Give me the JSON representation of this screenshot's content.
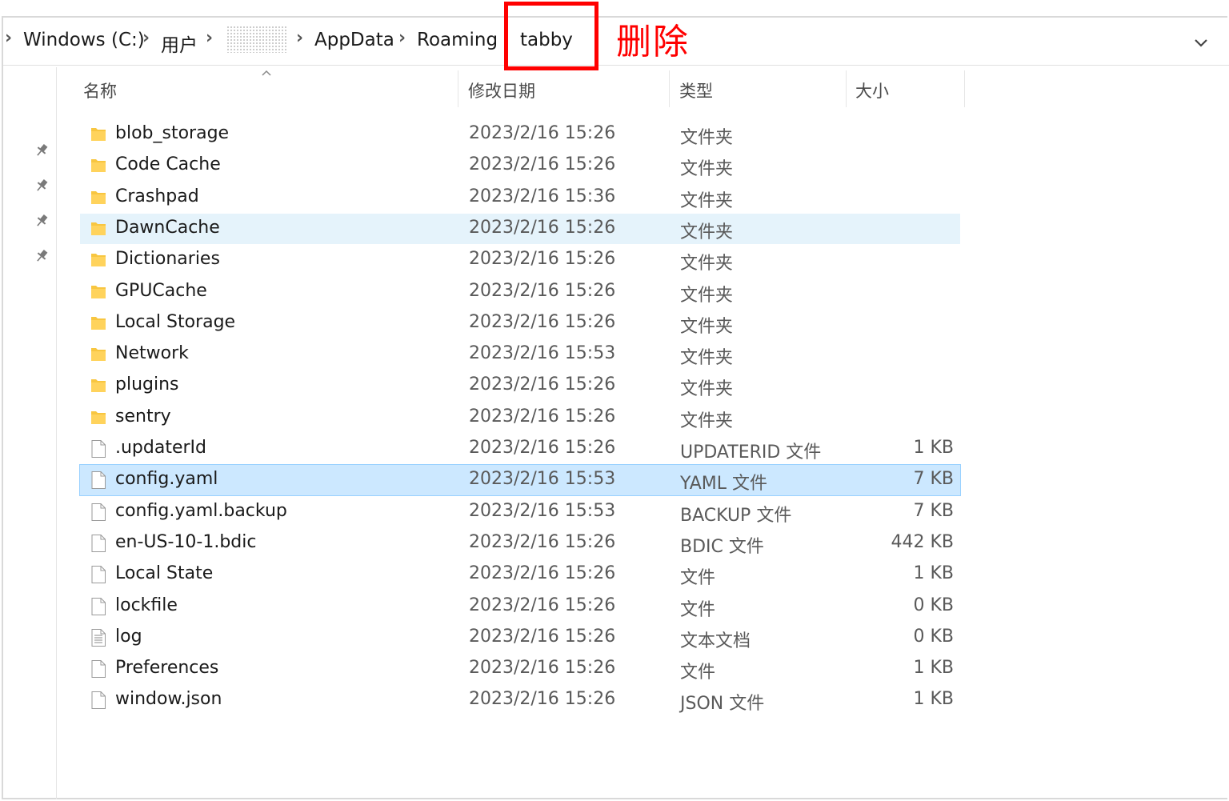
{
  "breadcrumb": {
    "items": [
      "Windows (C:)",
      "用户",
      "",
      "AppData",
      "Roaming",
      "tabby"
    ]
  },
  "annotation": {
    "text": "删除",
    "color": "#ff0000"
  },
  "columns": {
    "name": "名称",
    "date": "修改日期",
    "type": "类型",
    "size": "大小"
  },
  "files": [
    {
      "name": "blob_storage",
      "date": "2023/2/16 15:26",
      "type": "文件夹",
      "size": "",
      "icon": "folder-icon"
    },
    {
      "name": "Code Cache",
      "date": "2023/2/16 15:26",
      "type": "文件夹",
      "size": "",
      "icon": "folder-icon"
    },
    {
      "name": "Crashpad",
      "date": "2023/2/16 15:36",
      "type": "文件夹",
      "size": "",
      "icon": "folder-icon"
    },
    {
      "name": "DawnCache",
      "date": "2023/2/16 15:26",
      "type": "文件夹",
      "size": "",
      "icon": "folder-icon"
    },
    {
      "name": "Dictionaries",
      "date": "2023/2/16 15:26",
      "type": "文件夹",
      "size": "",
      "icon": "folder-icon"
    },
    {
      "name": "GPUCache",
      "date": "2023/2/16 15:26",
      "type": "文件夹",
      "size": "",
      "icon": "folder-icon"
    },
    {
      "name": "Local Storage",
      "date": "2023/2/16 15:26",
      "type": "文件夹",
      "size": "",
      "icon": "folder-icon"
    },
    {
      "name": "Network",
      "date": "2023/2/16 15:53",
      "type": "文件夹",
      "size": "",
      "icon": "folder-icon"
    },
    {
      "name": "plugins",
      "date": "2023/2/16 15:26",
      "type": "文件夹",
      "size": "",
      "icon": "folder-icon"
    },
    {
      "name": "sentry",
      "date": "2023/2/16 15:26",
      "type": "文件夹",
      "size": "",
      "icon": "folder-icon"
    },
    {
      "name": ".updaterId",
      "date": "2023/2/16 15:26",
      "type": "UPDATERID 文件",
      "size": "1 KB",
      "icon": "file-icon"
    },
    {
      "name": "config.yaml",
      "date": "2023/2/16 15:53",
      "type": "YAML 文件",
      "size": "7 KB",
      "icon": "file-icon"
    },
    {
      "name": "config.yaml.backup",
      "date": "2023/2/16 15:53",
      "type": "BACKUP 文件",
      "size": "7 KB",
      "icon": "file-icon"
    },
    {
      "name": "en-US-10-1.bdic",
      "date": "2023/2/16 15:26",
      "type": "BDIC 文件",
      "size": "442 KB",
      "icon": "file-icon"
    },
    {
      "name": "Local State",
      "date": "2023/2/16 15:26",
      "type": "文件",
      "size": "1 KB",
      "icon": "file-icon"
    },
    {
      "name": "lockfile",
      "date": "2023/2/16 15:26",
      "type": "文件",
      "size": "0 KB",
      "icon": "file-icon"
    },
    {
      "name": "log",
      "date": "2023/2/16 15:26",
      "type": "文本文档",
      "size": "0 KB",
      "icon": "text-file-icon"
    },
    {
      "name": "Preferences",
      "date": "2023/2/16 15:26",
      "type": "文件",
      "size": "1 KB",
      "icon": "file-icon"
    },
    {
      "name": "window.json",
      "date": "2023/2/16 15:26",
      "type": "JSON 文件",
      "size": "1 KB",
      "icon": "file-icon"
    }
  ],
  "hovered_row": "DawnCache",
  "selected_row": "config.yaml",
  "colors": {
    "folder": "#f8c640",
    "selection": "#cce8ff",
    "hover": "#e5f3fb"
  }
}
